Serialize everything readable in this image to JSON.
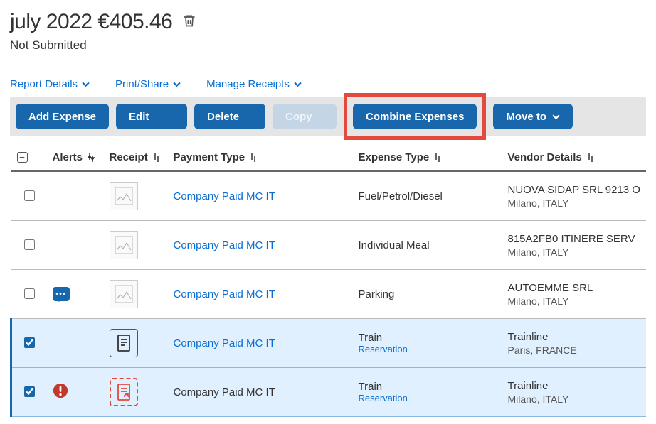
{
  "header": {
    "title": "july 2022 €405.46",
    "status": "Not Submitted"
  },
  "links": {
    "report_details": "Report Details",
    "print_share": "Print/Share",
    "manage_receipts": "Manage Receipts"
  },
  "toolbar": {
    "add_expense": "Add Expense",
    "edit": "Edit",
    "delete": "Delete",
    "copy": "Copy",
    "combine": "Combine Expenses",
    "move_to": "Move to"
  },
  "columns": {
    "alerts": "Alerts",
    "receipt": "Receipt",
    "payment_type": "Payment Type",
    "expense_type": "Expense Type",
    "vendor_details": "Vendor Details"
  },
  "rows": [
    {
      "checked": false,
      "alert": "none",
      "receipt_style": "thumb",
      "payment_type": "Company Paid MC IT",
      "payment_link": true,
      "expense_type": "Fuel/Petrol/Diesel",
      "expense_sub": "",
      "vendor": "NUOVA SIDAP SRL 9213 O",
      "vendor_loc": "Milano, ITALY"
    },
    {
      "checked": false,
      "alert": "none",
      "receipt_style": "thumb",
      "payment_type": "Company Paid MC IT",
      "payment_link": true,
      "expense_type": "Individual Meal",
      "expense_sub": "",
      "vendor": "815A2FB0 ITINERE SERV",
      "vendor_loc": "Milano, ITALY"
    },
    {
      "checked": false,
      "alert": "comment",
      "receipt_style": "thumb",
      "payment_type": "Company Paid MC IT",
      "payment_link": true,
      "expense_type": "Parking",
      "expense_sub": "",
      "vendor": "AUTOEMME SRL",
      "vendor_loc": "Milano, ITALY"
    },
    {
      "checked": true,
      "alert": "none",
      "receipt_style": "icon",
      "payment_type": "Company Paid MC IT",
      "payment_link": true,
      "expense_type": "Train",
      "expense_sub": "Reservation",
      "vendor": "Trainline",
      "vendor_loc": "Paris, FRANCE"
    },
    {
      "checked": true,
      "alert": "error",
      "receipt_style": "missing",
      "payment_type": "Company Paid MC IT",
      "payment_link": false,
      "expense_type": "Train",
      "expense_sub": "Reservation",
      "vendor": "Trainline",
      "vendor_loc": "Milano, ITALY"
    }
  ]
}
